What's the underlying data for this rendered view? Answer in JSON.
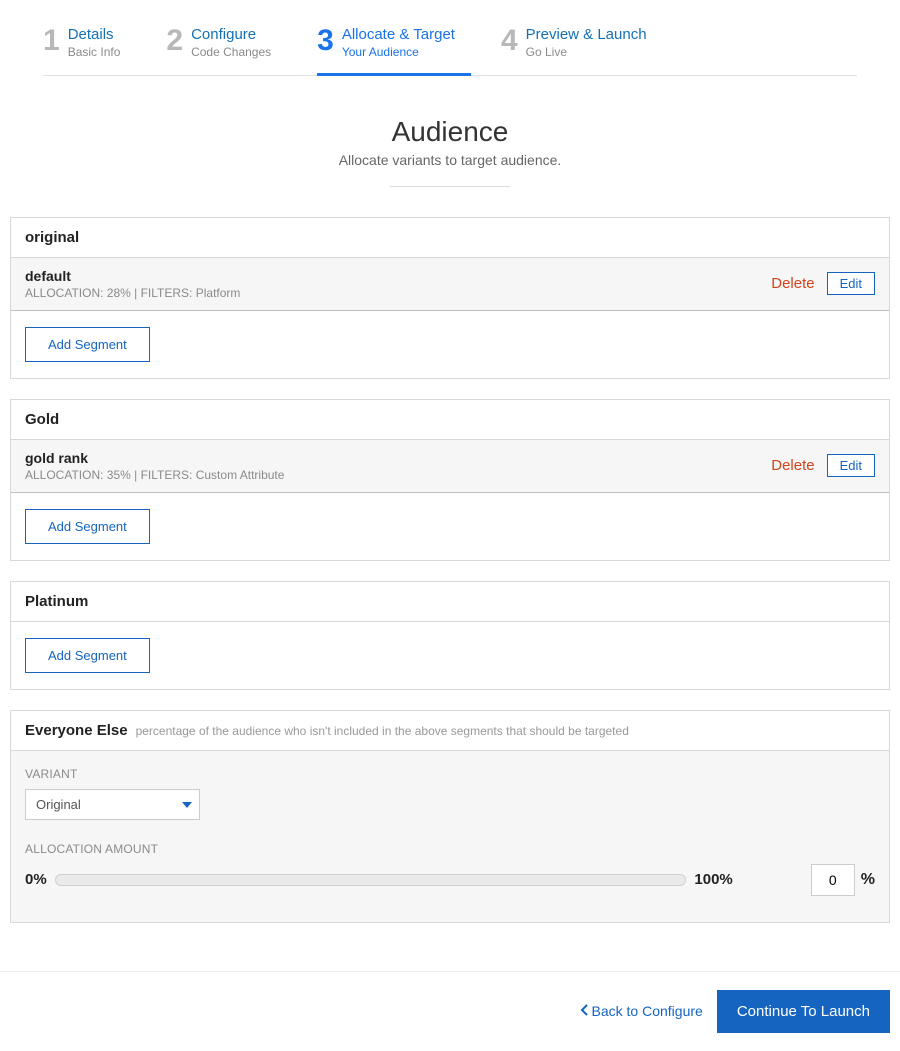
{
  "wizard": {
    "steps": [
      {
        "num": "1",
        "title": "Details",
        "sub": "Basic Info"
      },
      {
        "num": "2",
        "title": "Configure",
        "sub": "Code Changes"
      },
      {
        "num": "3",
        "title": "Allocate & Target",
        "sub": "Your Audience"
      },
      {
        "num": "4",
        "title": "Preview & Launch",
        "sub": "Go Live"
      }
    ]
  },
  "heading": {
    "title": "Audience",
    "subtitle": "Allocate variants to target audience."
  },
  "variants": [
    {
      "name": "original",
      "segments": [
        {
          "name": "default",
          "meta": "ALLOCATION: 28%  |  FILTERS: Platform"
        }
      ]
    },
    {
      "name": "Gold",
      "segments": [
        {
          "name": "gold rank",
          "meta": "ALLOCATION: 35%  |  FILTERS: Custom Attribute"
        }
      ]
    },
    {
      "name": "Platinum",
      "segments": []
    }
  ],
  "buttons": {
    "addSegment": "Add Segment",
    "delete": "Delete",
    "edit": "Edit"
  },
  "everyone": {
    "title": "Everyone Else",
    "hint": "percentage of the audience who isn't included in the above segments that should be targeted",
    "variantLabel": "VARIANT",
    "variantSelected": "Original",
    "allocationLabel": "ALLOCATION AMOUNT",
    "min": "0%",
    "max": "100%",
    "value": "0",
    "pct": "%"
  },
  "footer": {
    "back": "Back to Configure",
    "next": "Continue To Launch"
  }
}
